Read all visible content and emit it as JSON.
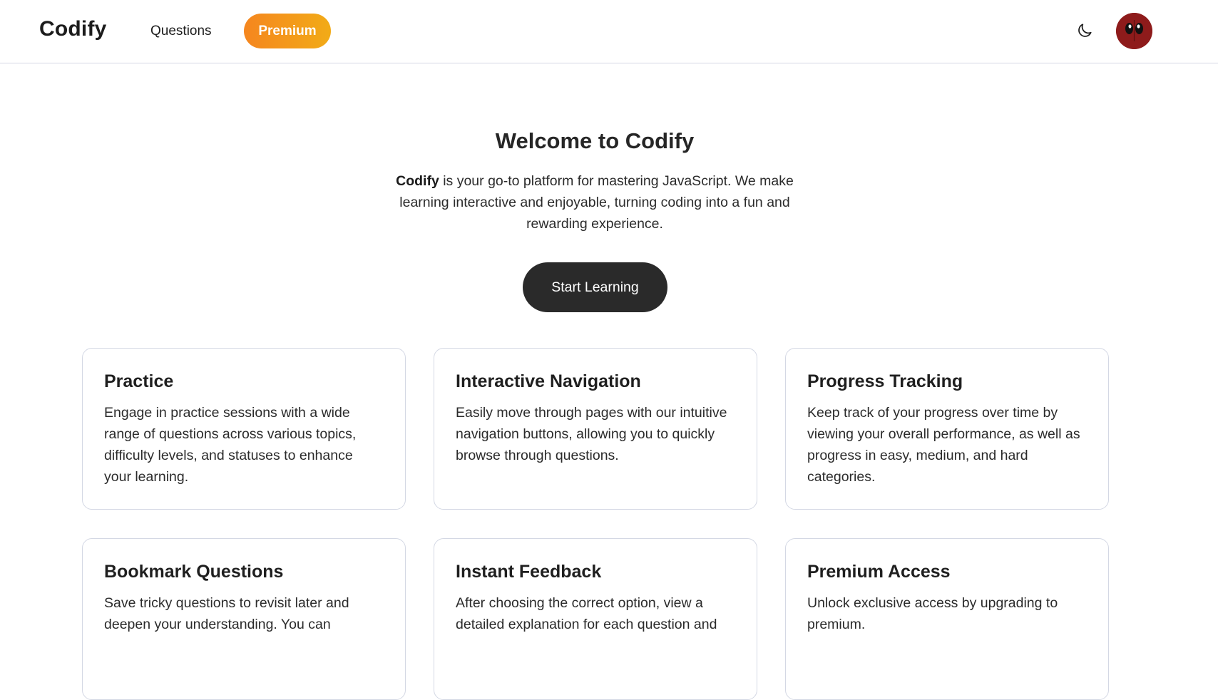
{
  "navbar": {
    "brand": "Codify",
    "links": [
      {
        "label": "Questions"
      }
    ],
    "premium_label": "Premium",
    "theme_icon": "moon-icon",
    "avatar_icon": "avatar-mask-icon"
  },
  "hero": {
    "title": "Welcome to Codify",
    "intro_bold": "Codify",
    "intro_rest": " is your go-to platform for mastering JavaScript. We make learning interactive and enjoyable, turning coding into a fun and rewarding experience.",
    "cta_label": "Start Learning"
  },
  "features": [
    {
      "title": "Practice",
      "description": "Engage in practice sessions with a wide range of questions across various topics, difficulty levels, and statuses to enhance your learning."
    },
    {
      "title": "Interactive Navigation",
      "description": "Easily move through pages with our intuitive navigation buttons, allowing you to quickly browse through questions."
    },
    {
      "title": "Progress Tracking",
      "description": "Keep track of your progress over time by viewing your overall performance, as well as progress in easy, medium, and hard categories."
    },
    {
      "title": "Bookmark Questions",
      "description": "Save tricky questions to revisit later and deepen your understanding. You can"
    },
    {
      "title": "Instant Feedback",
      "description": "After choosing the correct option, view a detailed explanation for each question and"
    },
    {
      "title": "Premium Access",
      "description": "Unlock exclusive access by upgrading to premium."
    }
  ],
  "colors": {
    "premium_gradient_start": "#f5861f",
    "premium_gradient_end": "#f2ab17",
    "cta_background": "#2a2a2a",
    "border": "#d4d8e4"
  }
}
